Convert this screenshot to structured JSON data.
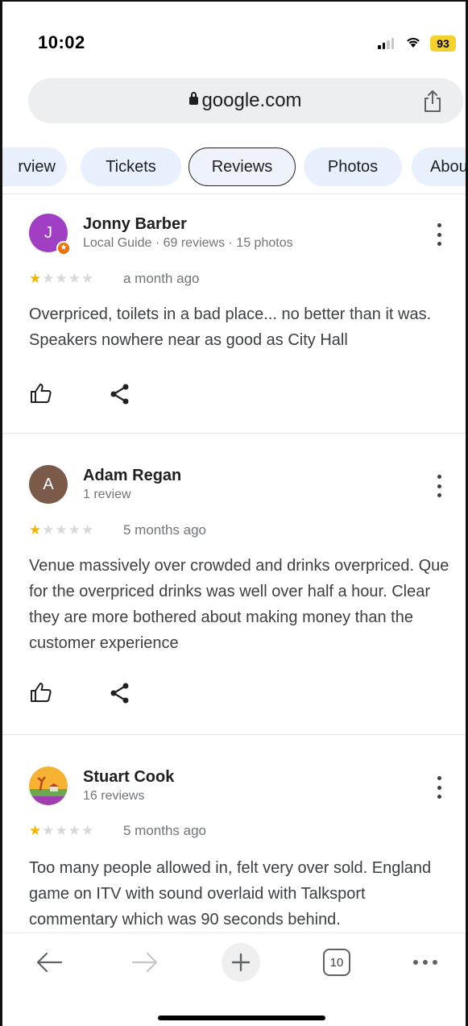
{
  "status_bar": {
    "time": "10:02",
    "battery": "93",
    "battery_color": "#f4d12f"
  },
  "browser": {
    "url": "google.com"
  },
  "tabs": [
    {
      "label": "rview"
    },
    {
      "label": "Tickets"
    },
    {
      "label": "Reviews",
      "active": true
    },
    {
      "label": "Photos"
    },
    {
      "label": "Abou"
    }
  ],
  "reviews": [
    {
      "initial": "J",
      "avatar_color": "#a03fc4",
      "name": "Jonny Barber",
      "meta": "Local Guide · 69 reviews · 15 photos",
      "rating": 1,
      "when": "a month ago",
      "text": "Overpriced, toilets in a bad place... no better than it was. Speakers nowhere near as good as City Hall"
    },
    {
      "initial": "A",
      "avatar_color": "#7b5a4a",
      "name": "Adam Regan",
      "meta": "1 review",
      "rating": 1,
      "when": "5 months ago",
      "text": "Venue massively over crowded and drinks overpriced. Que for the overpriced drinks was well over half a hour. Clear they are more bothered about making money than the customer experience"
    },
    {
      "initial": "",
      "name": "Stuart Cook",
      "meta": "16 reviews",
      "rating": 1,
      "when": "5 months ago",
      "text": "Too many people allowed in, felt very over sold. England game on ITV with sound overlaid with Talksport commentary which was 90 seconds behind."
    }
  ],
  "toolbar": {
    "tab_count": "10"
  },
  "colors": {
    "accent_star": "#f4b400",
    "chip_bg": "#e8f0fe"
  }
}
